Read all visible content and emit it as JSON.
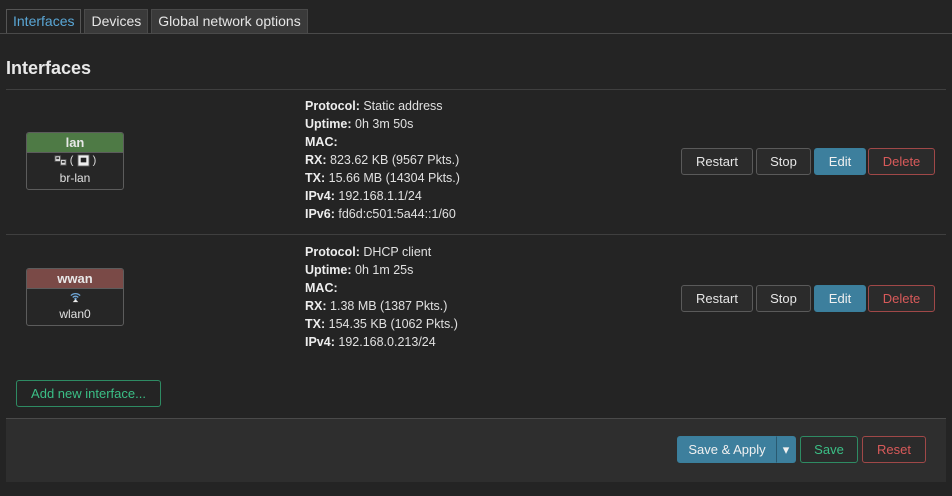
{
  "tabs": [
    {
      "label": "Interfaces"
    },
    {
      "label": "Devices"
    },
    {
      "label": "Global network options"
    }
  ],
  "page_title": "Interfaces",
  "interfaces": [
    {
      "name": "lan",
      "device": "br-lan",
      "icons": [
        "bridge-icon",
        "ethernet-port-icon"
      ],
      "status": {
        "protocol_label": "Protocol:",
        "protocol": "Static address",
        "uptime_label": "Uptime:",
        "uptime": "0h 3m 50s",
        "mac_label": "MAC:",
        "mac": "",
        "rx_label": "RX:",
        "rx": "823.62 KB (9567 Pkts.)",
        "tx_label": "TX:",
        "tx": "15.66 MB (14304 Pkts.)",
        "ipv4_label": "IPv4:",
        "ipv4": "192.168.1.1/24",
        "ipv6_label": "IPv6:",
        "ipv6": "fd6d:c501:5a44::1/60"
      }
    },
    {
      "name": "wwan",
      "device": "wlan0",
      "icons": [
        "wifi-icon"
      ],
      "status": {
        "protocol_label": "Protocol:",
        "protocol": "DHCP client",
        "uptime_label": "Uptime:",
        "uptime": "0h 1m 25s",
        "mac_label": "MAC:",
        "mac": "",
        "rx_label": "RX:",
        "rx": "1.38 MB (1387 Pkts.)",
        "tx_label": "TX:",
        "tx": "154.35 KB (1062 Pkts.)",
        "ipv4_label": "IPv4:",
        "ipv4": "192.168.0.213/24"
      }
    }
  ],
  "row_actions": {
    "restart": "Restart",
    "stop": "Stop",
    "edit": "Edit",
    "delete": "Delete"
  },
  "add_button": "Add new interface...",
  "footer": {
    "save_apply": "Save & Apply",
    "dropdown_arrow": "▾",
    "save": "Save",
    "reset": "Reset"
  },
  "colors": {
    "accent_blue": "#3d7f9d",
    "lan_header": "#4e7a45",
    "wwan_header": "#7a4a47",
    "positive_green": "#3bbf86",
    "danger_red": "#d85a5a"
  }
}
